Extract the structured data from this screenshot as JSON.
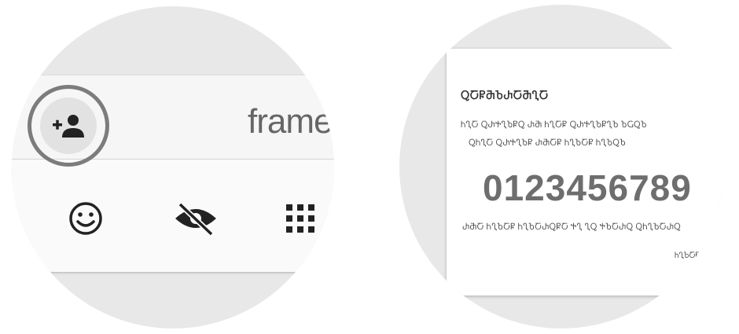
{
  "left_panel": {
    "add_contact_icon": "person-add-icon",
    "brand_text": "frame",
    "icons": [
      "smile-icon",
      "visibility-off-icon",
      "dialpad-icon"
    ]
  },
  "right_panel": {
    "sample_header": "ႭႠႼႫႦႰႠႫႢႠ",
    "sample_line_1": "ႹႢႠ ႭႰႵႢႦႼႭ ႰႫ ႹႢႠႼ ႭႰႵႢႦႼႢႦ ႦႺႭႦ",
    "sample_line_2": "ႭႹႢႠ ႭႰႵႢႦႼ ႰႫႠႼ ႹႢႦႠႼ ႹႢႦႭႦ",
    "digits": "0123456789",
    "sample_line_3": "ႰႫႠ ႹႢႦႠႼ ႹႢႦႠႰႭႼႠ ႵႢ ႢႭ ႵႦႠႰႭ ႭႹႢႦႠႰႭ",
    "sample_footer": "ႹႢႦႠႼ"
  },
  "colors": {
    "zoom_background": "#e8e8e8",
    "card_background": "#fafafa",
    "ring": "#7c7c7c",
    "icon": "#222222",
    "digits": "#6e6e6e"
  }
}
